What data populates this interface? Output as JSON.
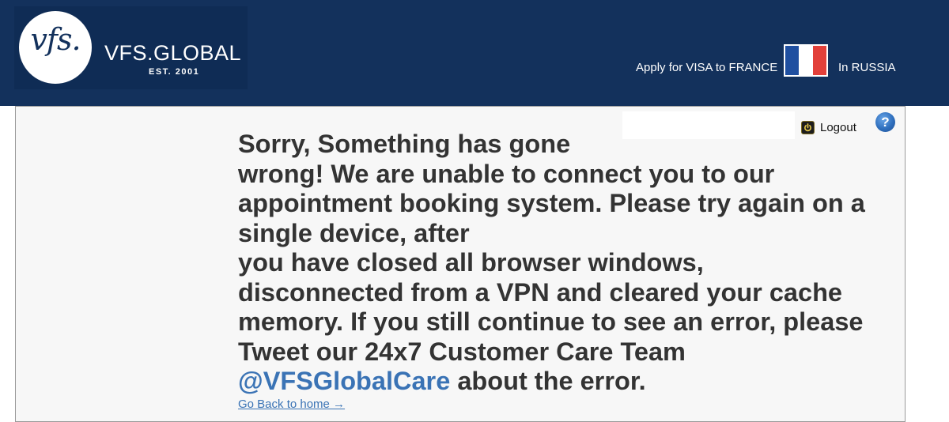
{
  "header": {
    "logo_mark": "vfs.",
    "brand_name": "VFS.GLOBAL",
    "brand_est": "EST. 2001",
    "apply_text": "Apply for VISA to FRANCE",
    "country_text": "In RUSSIA",
    "flag_colors": [
      "#1f4fa0",
      "#ffffff",
      "#e2403a"
    ],
    "flag_icon": "france-flag-icon"
  },
  "toolbar": {
    "logout_label": "Logout",
    "logout_icon": "power-icon",
    "help_label": "?",
    "help_icon": "help-icon"
  },
  "error": {
    "lines": [
      "Sorry, Something has gone",
      "wrong! We are unable to connect you to our",
      "appointment booking system. Please try again on a",
      "single device, after",
      "you have closed all browser windows,",
      "disconnected from a VPN and cleared your cache",
      "memory. If you still continue to see an error, please",
      "Tweet our 24x7 Customer Care Team"
    ],
    "twitter_handle": "@VFSGlobalCare",
    "last_line_suffix": " about the error."
  },
  "back_link": "Go Back to home →",
  "colors": {
    "header_bg": "#13315c",
    "link": "#3a73b5",
    "text": "#333333",
    "panel_bg": "#f7f7f7"
  }
}
